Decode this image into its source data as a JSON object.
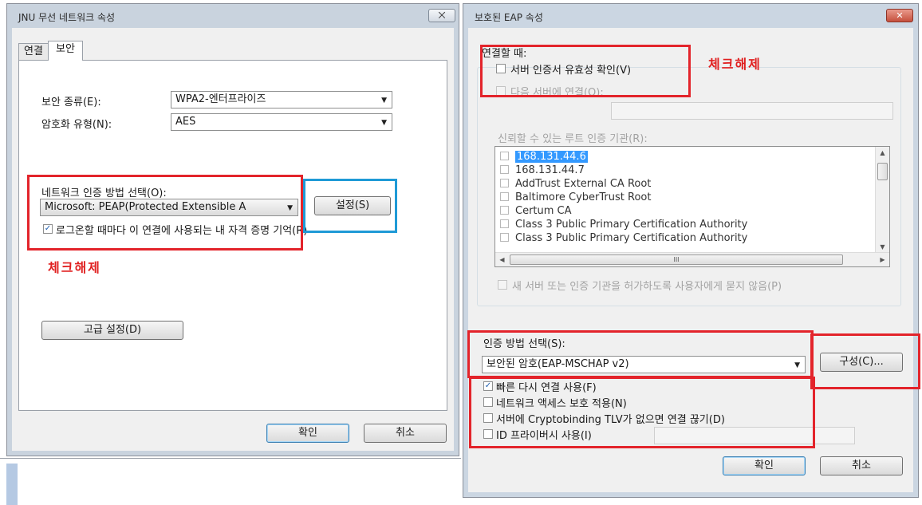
{
  "left_window": {
    "title": "JNU 무선 네트워크 속성",
    "close_label": "⨉",
    "tabs": [
      {
        "label": "연결"
      },
      {
        "label": "보안"
      }
    ],
    "security_type_label": "보안 종류(E):",
    "security_type_value": "WPA2-엔터프라이즈",
    "encryption_type_label": "암호화 유형(N):",
    "encryption_type_value": "AES",
    "auth_method_label": "네트워크 인증 방법 선택(O):",
    "auth_method_value": "Microsoft: PEAP(Protected Extensible A",
    "settings_button": "설정(S)",
    "remember_checkbox_label": "로그온할 때마다 이 연결에 사용되는 내 자격 증명 기억(R)",
    "remember_checked": "✓",
    "annotation": "체크해제",
    "advanced_button": "고급 설정(D)",
    "ok_button": "확인",
    "cancel_button": "취소"
  },
  "right_window": {
    "title": "보호된 EAP 속성",
    "close_label": "✕",
    "connect_when_label": "연결할 때:",
    "validate_cert_label": "서버 인증서 유효성 확인(V)",
    "connect_to_servers_label": "다음 서버에 연결(O):",
    "annotation": "체크해제",
    "trusted_ca_label": "신뢰할 수 있는 루트 인증 기관(R):",
    "ca_list": [
      "168.131.44.6",
      "168.131.44.7",
      "AddTrust External CA Root",
      "Baltimore CyberTrust Root",
      "Certum CA",
      "Class 3 Public Primary Certification Authority",
      "Class 3 Public Primary Certification Authority"
    ],
    "hscroll_grip": "III",
    "no_prompt_label": "새 서버 또는 인증 기관을 허가하도록 사용자에게 묻지 않음(P)",
    "auth_method_label": "인증 방법 선택(S):",
    "auth_method_value": "보안된 암호(EAP-MSCHAP v2)",
    "configure_button": "구성(C)...",
    "fast_reconnect_label": "빠른 다시 연결 사용(F)",
    "fast_reconnect_checked": "✓",
    "nap_label": "네트워크 액세스 보호 적용(N)",
    "cryptobinding_label": "서버에 Cryptobinding TLV가 없으면 연결 끊기(D)",
    "identity_privacy_label": "ID 프라이버시 사용(I)",
    "ok_button": "확인",
    "cancel_button": "취소"
  },
  "colors": {
    "annotation_red": "#e3242b",
    "annotation_blue": "#1f9ad6",
    "selection": "#3399ff"
  }
}
